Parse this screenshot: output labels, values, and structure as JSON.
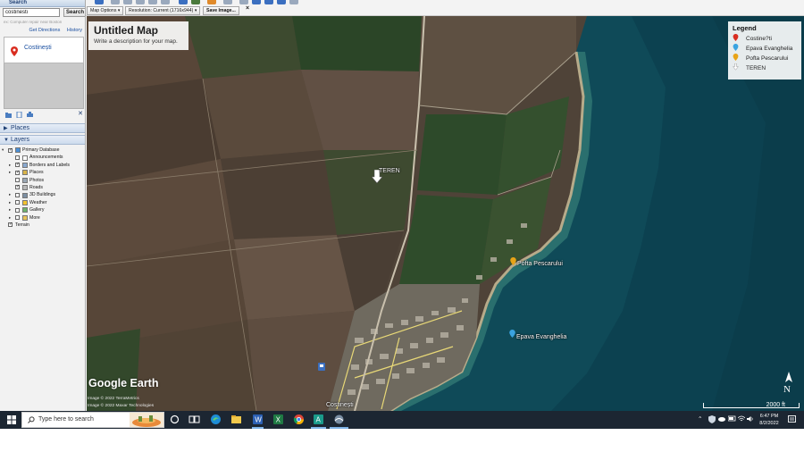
{
  "sidebar": {
    "search_header": "Search",
    "search_input": "costinesti",
    "search_button": "Search",
    "hint": "ex: Computer repair near Boston",
    "get_directions": "Get Directions",
    "history": "History",
    "result_label": "Costinești",
    "places_title": "Places",
    "layers_title": "Layers",
    "layers": [
      {
        "label": "Primary Database",
        "checked": true,
        "expand": "▾",
        "icon": "globe-icon",
        "indent": 0
      },
      {
        "label": "Announcements",
        "checked": false,
        "expand": "",
        "icon": "envelope-icon",
        "indent": 1
      },
      {
        "label": "Borders and Labels",
        "checked": true,
        "expand": "▸",
        "icon": "flag-icon",
        "indent": 1
      },
      {
        "label": "Places",
        "checked": true,
        "expand": "▸",
        "icon": "places-icon",
        "indent": 1
      },
      {
        "label": "Photos",
        "checked": false,
        "expand": "",
        "icon": "camera-icon",
        "indent": 1
      },
      {
        "label": "Roads",
        "checked": true,
        "expand": "",
        "icon": "road-icon",
        "indent": 1
      },
      {
        "label": "3D Buildings",
        "checked": false,
        "expand": "▸",
        "icon": "buildings-icon",
        "indent": 1
      },
      {
        "label": "Weather",
        "checked": false,
        "expand": "▸",
        "icon": "sun-icon",
        "indent": 1
      },
      {
        "label": "Gallery",
        "checked": false,
        "expand": "▸",
        "icon": "gallery-icon",
        "indent": 1
      },
      {
        "label": "More",
        "checked": false,
        "expand": "▸",
        "icon": "folder-icon",
        "indent": 1
      },
      {
        "label": "Terrain",
        "checked": true,
        "expand": "",
        "icon": "",
        "indent": 0
      }
    ]
  },
  "toolbar": {
    "map_options": "Map Options",
    "resolution": "Resolution: Current (1716x944)",
    "save_image": "Save Image...",
    "close": "×"
  },
  "map": {
    "title": "Untitled Map",
    "description": "Write a description for your map.",
    "legend_title": "Legend",
    "legend_items": [
      {
        "label": "Costine?ti",
        "color": "#d92d20",
        "icon": "pin-icon"
      },
      {
        "label": "Epava Evanghelia",
        "color": "#3aa3e0",
        "icon": "pin-icon"
      },
      {
        "label": "Pofta Pescarului",
        "color": "#e8a317",
        "icon": "pin-icon"
      },
      {
        "label": "TEREN",
        "color": "#ffffff",
        "icon": "arrow-icon"
      }
    ],
    "labels": {
      "teren": "TEREN",
      "pofta": "Pofta Pescarului",
      "epava": "Epava Evanghelia",
      "town": "Costinești"
    },
    "brand": "Google Earth",
    "credit1": "Image © 2022 TerraMetrics",
    "credit2": "Image © 2022 Maxar Technologies",
    "scale": "2000 ft",
    "compass": "N"
  },
  "taskbar": {
    "search_placeholder": "Type here to search",
    "time": "6:47 PM",
    "date": "8/2/2022"
  },
  "colors": {
    "taskbar": "#1c2632",
    "sea": "#0e4a57",
    "field_brown": "#5c4a3c",
    "field_green": "#2f4a2c"
  }
}
